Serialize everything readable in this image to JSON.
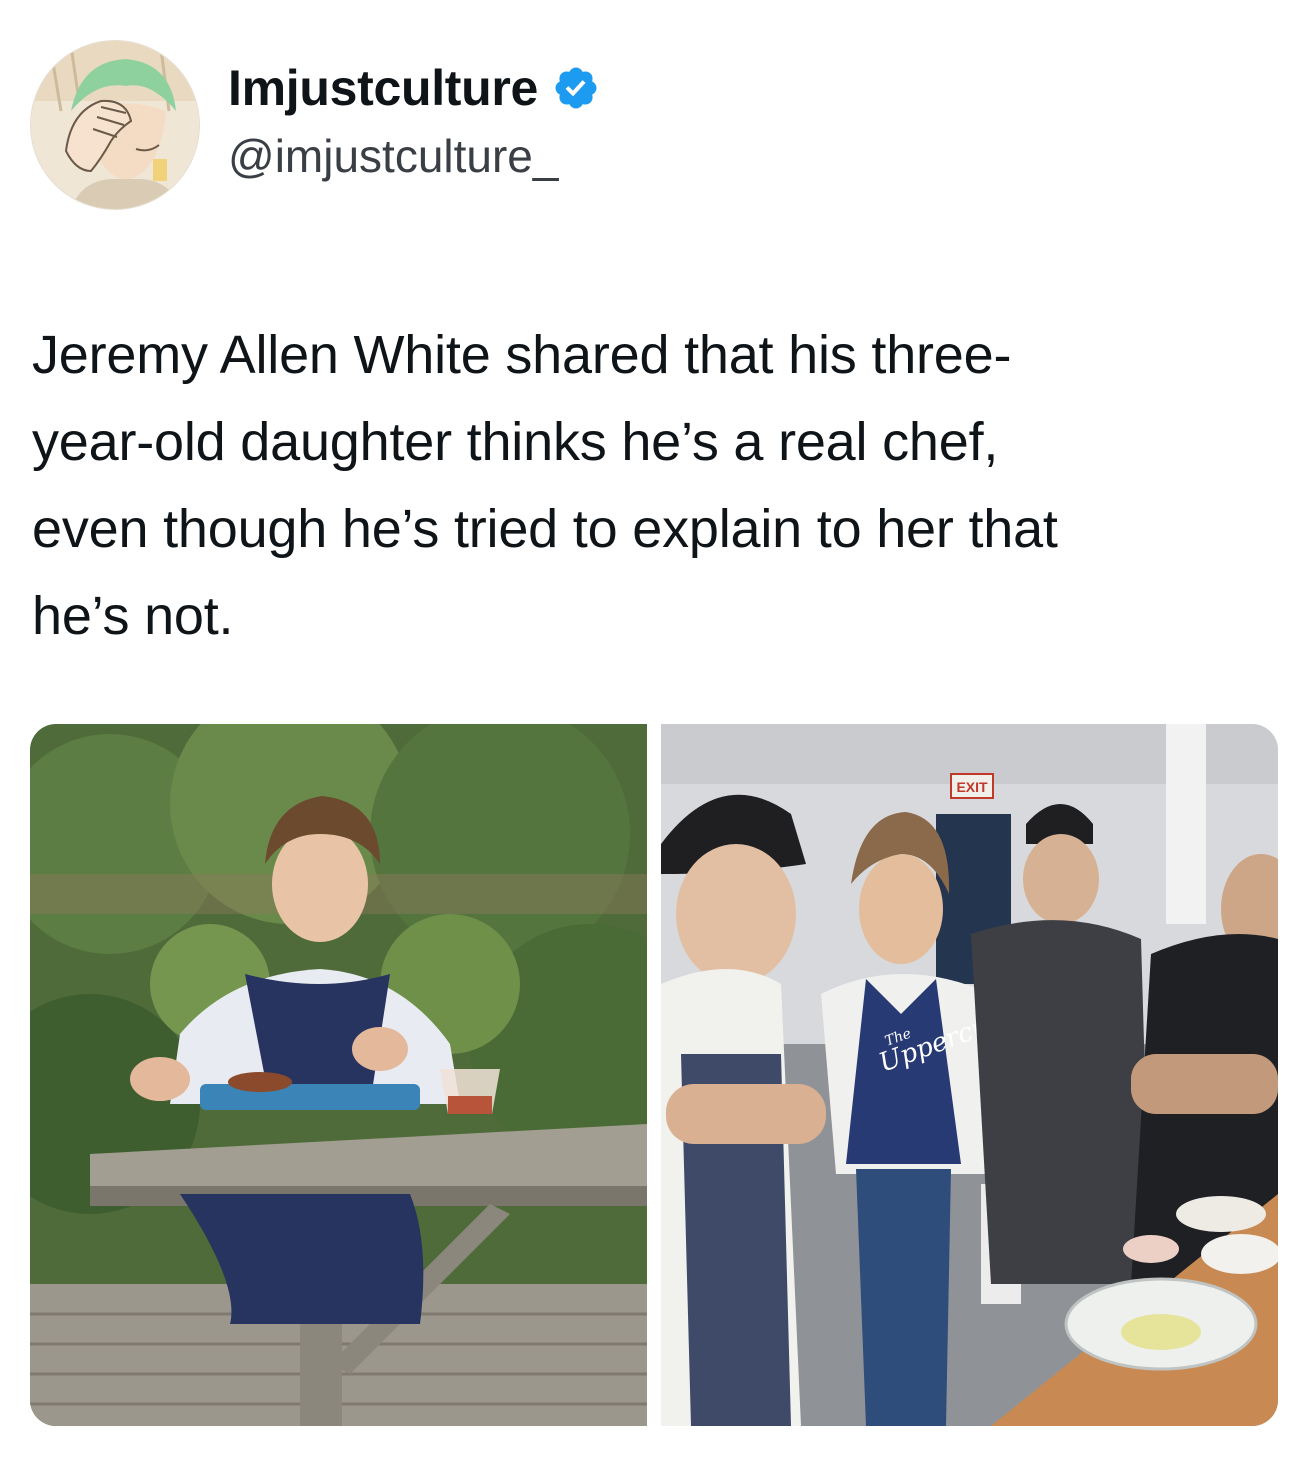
{
  "tweet": {
    "display_name": "Imjustculture",
    "handle": "@imjustculture_",
    "verified": true,
    "avatar_icon": "anime-avatar-icon",
    "text": "Jeremy Allen White shared that his three-\nyear-old daughter thinks he’s a real chef,\neven though he’s tried to explain to her that\nhe’s not."
  },
  "media": {
    "photos": [
      {
        "icon": "chef-at-picnic-table-photo"
      },
      {
        "icon": "kitchen-team-photo",
        "shirt_text": "Uppercut",
        "shirt_small_text": "The",
        "sign_text": "EXIT"
      }
    ]
  },
  "colors": {
    "verified_blue": "#1d9bf0",
    "text": "#0f1419",
    "handle": "#3a3f45"
  }
}
